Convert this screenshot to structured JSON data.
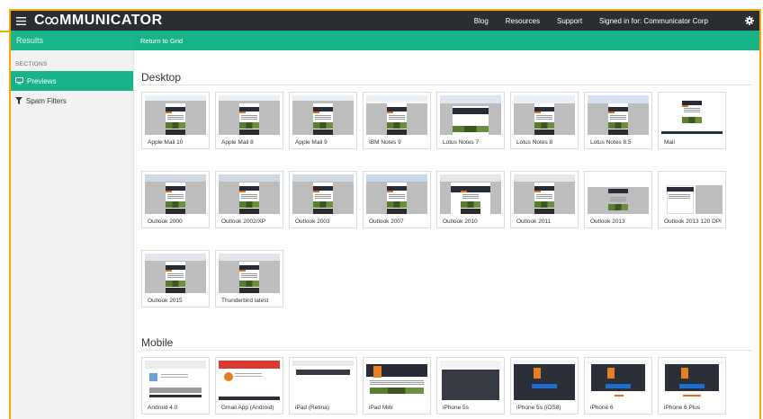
{
  "topbar": {
    "brand": "COMMUNICATOR",
    "brand_rest": "MMUNICATOR",
    "links": [
      "Blog",
      "Resources",
      "Support"
    ],
    "signed_in": "Signed in for: Communicator Corp"
  },
  "subbar": {
    "results": "Results",
    "return_label": "Return to Grid"
  },
  "sidebar": {
    "section_label": "SECTIONS",
    "items": [
      {
        "label": "Previews",
        "icon": "monitor-icon",
        "active": true
      },
      {
        "label": "Spam Filters",
        "icon": "filter-icon",
        "active": false
      }
    ]
  },
  "desktop": {
    "title": "Desktop",
    "clients": [
      "Apple Mail 10",
      "Apple Mail 8",
      "Apple Mail 9",
      "IBM Notes 9",
      "Lotus Notes 7",
      "Lotus Notes 8",
      "Lotus Notes 8.5",
      "Mail",
      "Outlook 2000",
      "Outlook 2002/XP",
      "Outlook 2003",
      "Outlook 2007",
      "Outlook 2010",
      "Outlook 2011",
      "Outlook 2013",
      "Outlook 2013 120 DPI",
      "Outlook 2015",
      "Thunderbird latest"
    ]
  },
  "mobile": {
    "title": "Mobile",
    "clients": [
      "Android 4.0",
      "Gmail App (Android)",
      "iPad (Retina)",
      "iPad Mini",
      "iPhone 5s",
      "iPhone 5s (iOS8)",
      "iPhone 6",
      "iPhone 6 Plus"
    ]
  },
  "colors": {
    "accent": "#17b38b",
    "topbar": "#2a2d31",
    "frame": "#f2a900"
  }
}
